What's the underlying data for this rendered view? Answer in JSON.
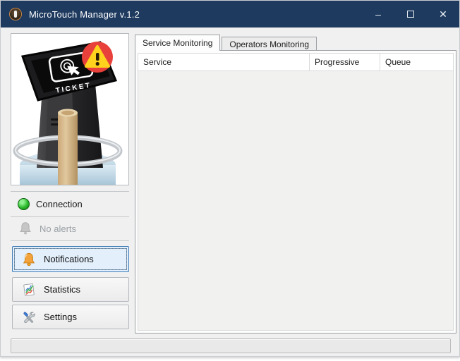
{
  "window": {
    "title": "MicroTouch Manager v.1.2",
    "controls": {
      "minimize_glyph": "–",
      "close_glyph": "✕"
    }
  },
  "sidebar": {
    "kiosk": {
      "screen_label": "TICKET",
      "alert": "warning"
    },
    "connection_label": "Connection",
    "no_alerts_label": "No alerts",
    "buttons": [
      {
        "label": "Notifications",
        "icon": "bell-icon",
        "state": "focused"
      },
      {
        "label": "Statistics",
        "icon": "chart-icon",
        "state": "normal"
      },
      {
        "label": "Settings",
        "icon": "tools-icon",
        "state": "normal"
      }
    ]
  },
  "main": {
    "tabs": [
      {
        "label": "Service Monitoring",
        "active": true
      },
      {
        "label": "Operators Monitoring",
        "active": false
      }
    ],
    "table": {
      "columns": [
        "Service",
        "Progressive",
        "Queue"
      ],
      "rows": []
    }
  },
  "status_bar": {
    "text": ""
  },
  "colors": {
    "titlebar": "#1e3a5f",
    "connection_ok": "#2dbb2d",
    "alert_badge": "#e8403a",
    "warning_yellow": "#ffd21e",
    "focus_border": "#3f7cb5",
    "focus_bg": "#e3effb",
    "bell_orange": "#f2a33c"
  }
}
